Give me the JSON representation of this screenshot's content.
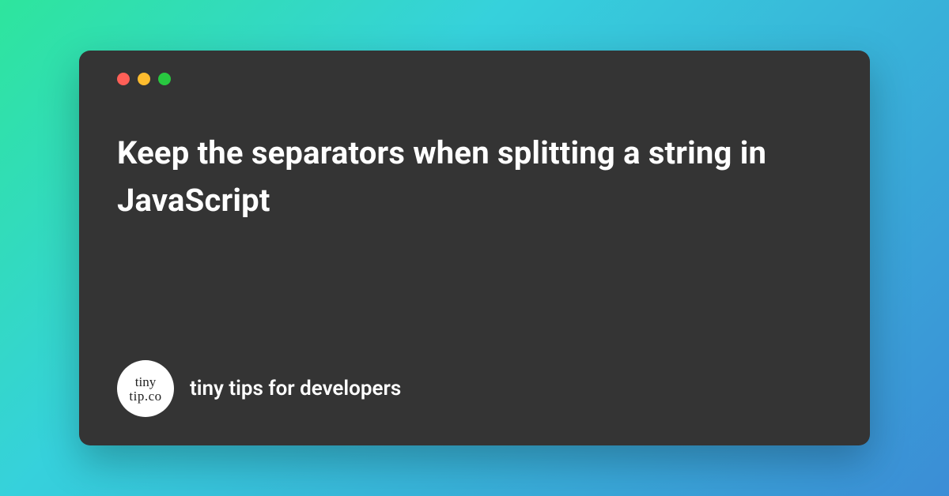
{
  "title": "Keep the separators when splitting a string in JavaScript",
  "logo": {
    "line1": "tiny",
    "line2": "tip.co"
  },
  "tagline": "tiny tips for developers",
  "colors": {
    "window_bg": "#343434",
    "text": "#ffffff",
    "gradient_start": "#2ee59d",
    "gradient_mid": "#36d1dc",
    "gradient_end": "#3b8dd6",
    "dot_red": "#ff5f57",
    "dot_yellow": "#febc2e",
    "dot_green": "#28c840"
  }
}
